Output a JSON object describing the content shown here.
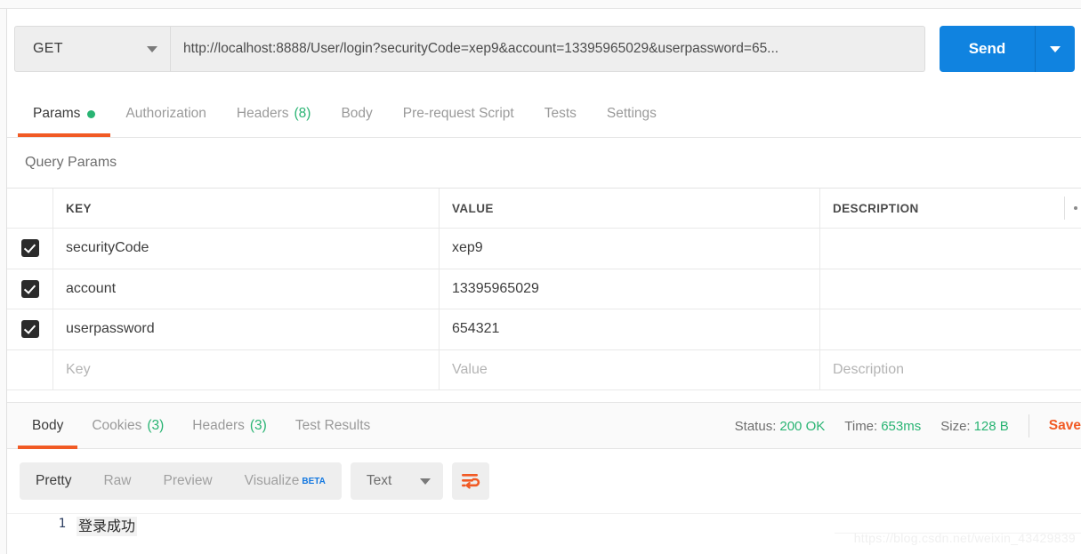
{
  "request": {
    "method": "GET",
    "url": "http://localhost:8888/User/login?securityCode=xep9&account=13395965029&userpassword=65...",
    "send_label": "Send",
    "tabs": [
      {
        "label": "Params",
        "dot": true
      },
      {
        "label": "Authorization"
      },
      {
        "label": "Headers",
        "count": "(8)"
      },
      {
        "label": "Body"
      },
      {
        "label": "Pre-request Script"
      },
      {
        "label": "Tests"
      },
      {
        "label": "Settings"
      }
    ]
  },
  "query_params": {
    "section_title": "Query Params",
    "columns": {
      "key": "KEY",
      "value": "VALUE",
      "description": "DESCRIPTION"
    },
    "rows": [
      {
        "checked": true,
        "key": "securityCode",
        "value": "xep9",
        "description": ""
      },
      {
        "checked": true,
        "key": "account",
        "value": "13395965029",
        "description": ""
      },
      {
        "checked": true,
        "key": "userpassword",
        "value": "654321",
        "description": ""
      }
    ],
    "new_row": {
      "key": "Key",
      "value": "Value",
      "description": "Description"
    }
  },
  "response": {
    "tabs": [
      {
        "label": "Body"
      },
      {
        "label": "Cookies",
        "count": "(3)"
      },
      {
        "label": "Headers",
        "count": "(3)"
      },
      {
        "label": "Test Results"
      }
    ],
    "status_label": "Status:",
    "status_value": "200 OK",
    "time_label": "Time:",
    "time_value": "653ms",
    "size_label": "Size:",
    "size_value": "128 B",
    "save_label": "Save",
    "view_modes": [
      "Pretty",
      "Raw",
      "Preview",
      "Visualize"
    ],
    "beta_badge": "BETA",
    "format": "Text",
    "body_lines": [
      {
        "n": "1",
        "text": "登录成功"
      }
    ]
  },
  "watermark": "https://blog.csdn.net/weixin_43429839",
  "colors": {
    "accent_orange": "#f15a24",
    "send_blue": "#1083e0",
    "success_green": "#29b473",
    "beta_blue": "#1478e0"
  }
}
